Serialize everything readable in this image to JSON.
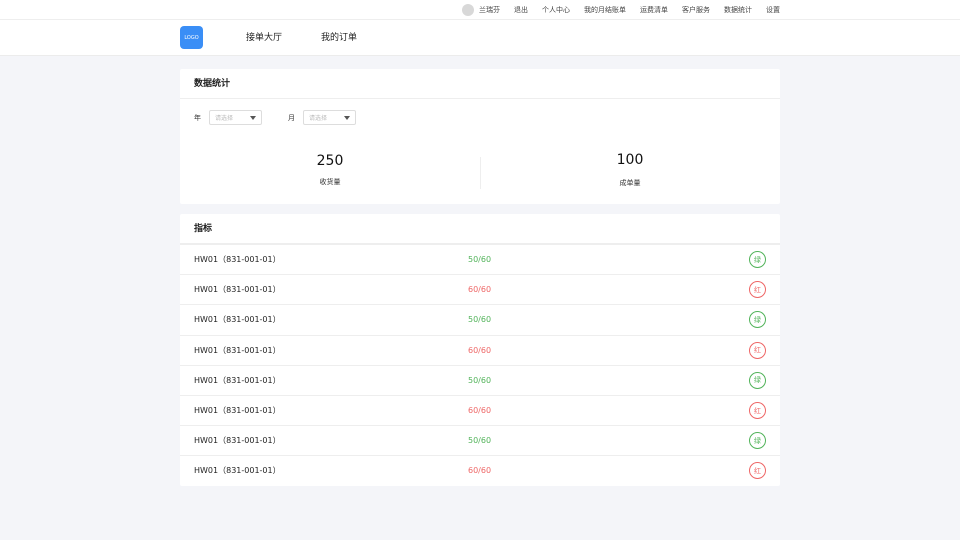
{
  "topbar": {
    "username": "兰瑞芬",
    "links": [
      "退出",
      "个人中心",
      "我的月结账单",
      "运费清单",
      "客户服务",
      "数据统计",
      "设置"
    ]
  },
  "nav": {
    "logo": "LOGO",
    "items": [
      "接单大厅",
      "我的订单"
    ]
  },
  "stats_card": {
    "title": "数据统计",
    "year_label": "年",
    "month_label": "月",
    "year_placeholder": "请选择",
    "month_placeholder": "请选择",
    "received": {
      "value": "250",
      "label": "收货量"
    },
    "orders": {
      "value": "100",
      "label": "成单量"
    }
  },
  "metrics_card": {
    "title": "指标",
    "rows": [
      {
        "name": "HW01（831-001-01）",
        "value": "50/60",
        "status": "绿",
        "color": "green"
      },
      {
        "name": "HW01（831-001-01）",
        "value": "60/60",
        "status": "红",
        "color": "red"
      },
      {
        "name": "HW01（831-001-01）",
        "value": "50/60",
        "status": "绿",
        "color": "green"
      },
      {
        "name": "HW01（831-001-01）",
        "value": "60/60",
        "status": "红",
        "color": "red"
      },
      {
        "name": "HW01（831-001-01）",
        "value": "50/60",
        "status": "绿",
        "color": "green"
      },
      {
        "name": "HW01（831-001-01）",
        "value": "60/60",
        "status": "红",
        "color": "red"
      },
      {
        "name": "HW01（831-001-01）",
        "value": "50/60",
        "status": "绿",
        "color": "green"
      },
      {
        "name": "HW01（831-001-01）",
        "value": "60/60",
        "status": "红",
        "color": "red"
      }
    ]
  },
  "colors": {
    "accent": "#3a8ef6",
    "green": "#52b35a",
    "red": "#ee6666"
  }
}
